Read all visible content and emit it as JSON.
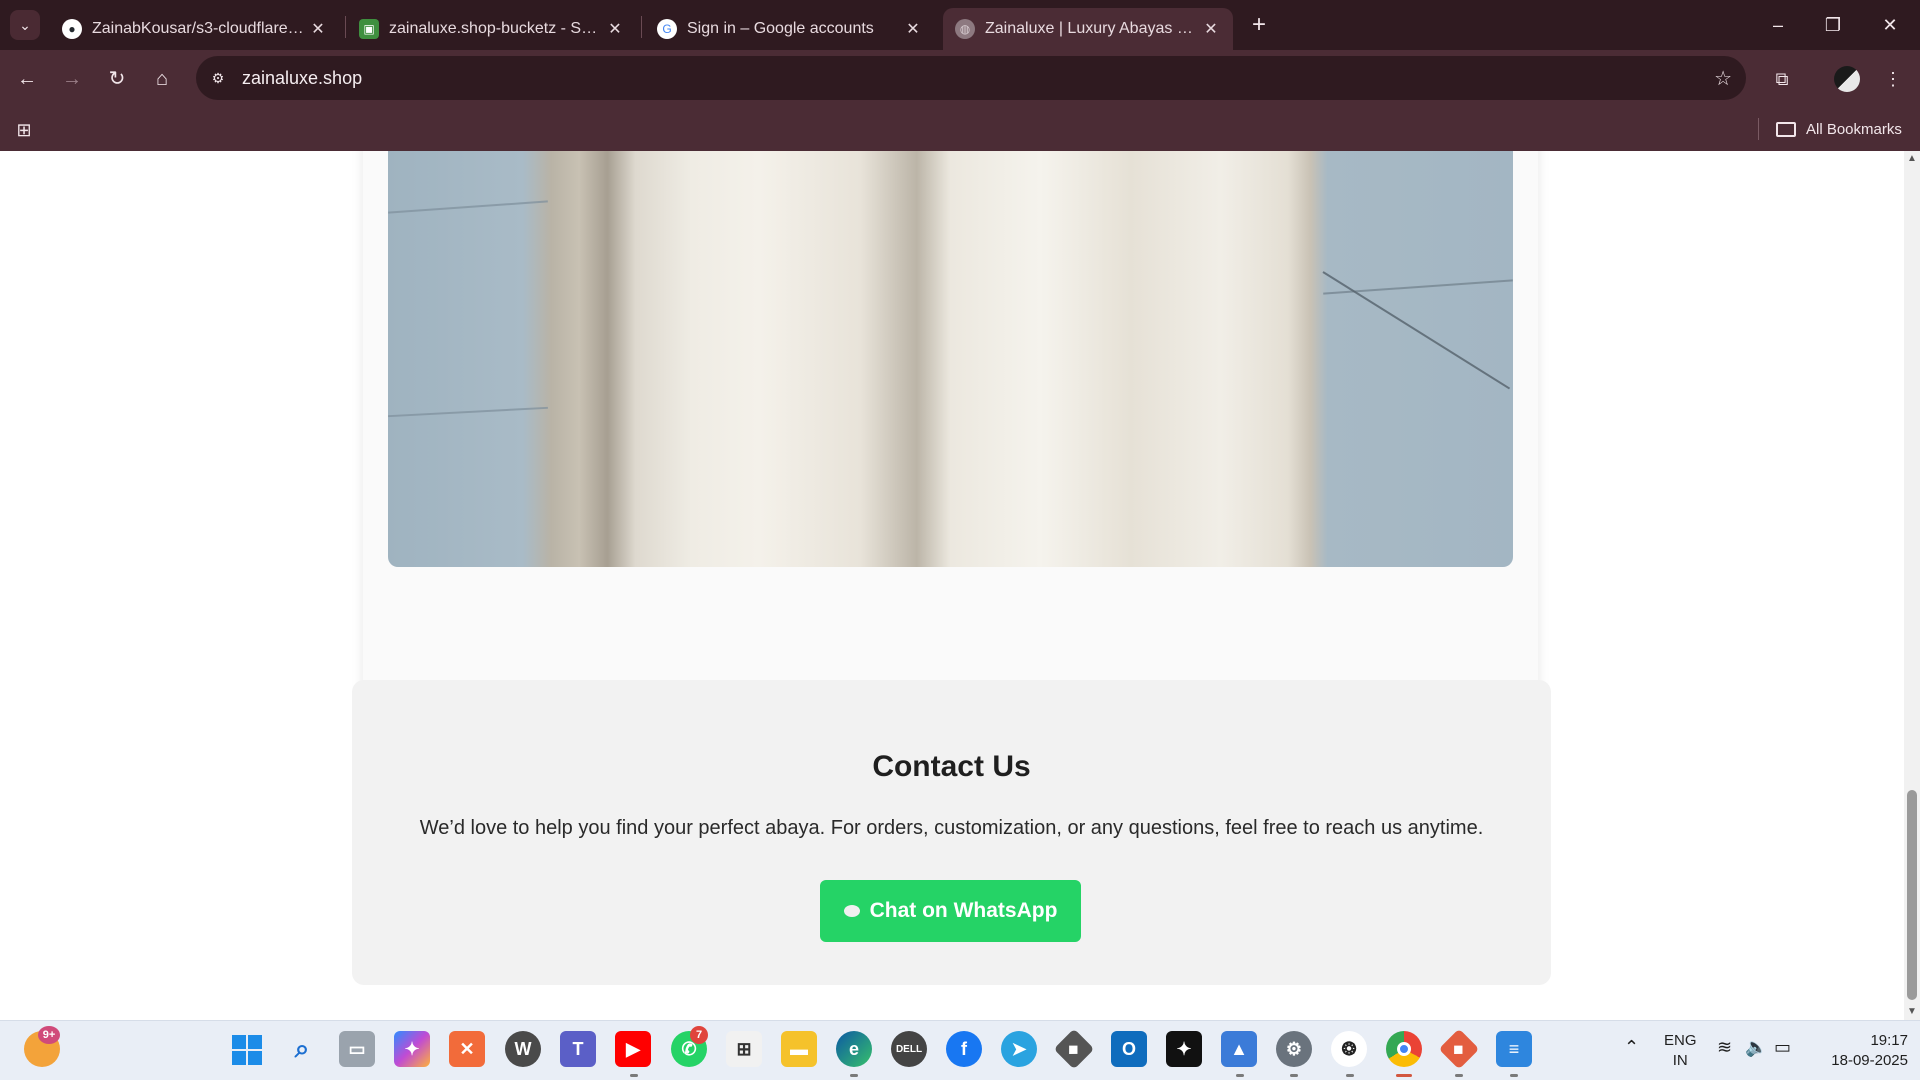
{
  "browser": {
    "tabs": [
      {
        "title": "ZainabKousar/s3-cloudflare-action",
        "favicon": "github-icon"
      },
      {
        "title": "zainaluxe.shop-bucketz - S3 bucket",
        "favicon": "s3-bucket-icon"
      },
      {
        "title": "Sign in – Google accounts",
        "favicon": "google-icon"
      },
      {
        "title": "Zainaluxe | Luxury Abayas & Modest",
        "favicon": "globe-icon",
        "active": true
      }
    ],
    "address": "zainaluxe.shop",
    "bookmarks_label": "All Bookmarks"
  },
  "page": {
    "image_alt": "abaya",
    "contact": {
      "heading": "Contact Us",
      "text": "We’d love to help you find your perfect abaya. For orders, customization, or any questions, feel free to reach us anytime.",
      "button_label": "Chat on WhatsApp",
      "button_color": "#25d366"
    }
  },
  "taskbar": {
    "weather_badge": "9+",
    "whatsapp_badge": "7",
    "language": "ENG",
    "region": "IN",
    "time": "19:17",
    "date": "18-09-2025"
  },
  "colors": {
    "browser_frame": "#3c1e26",
    "tabstrip": "#2f1a20",
    "whatsapp": "#25d366"
  }
}
